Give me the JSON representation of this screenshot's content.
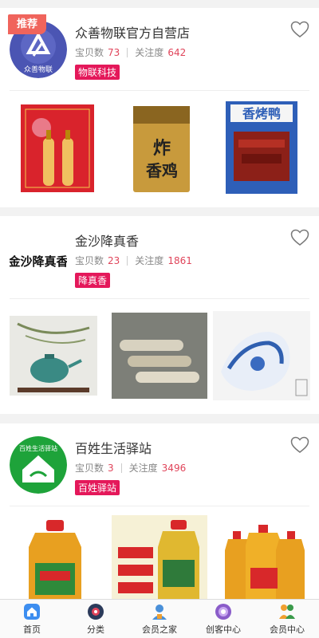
{
  "stores": [
    {
      "tag": "推荐",
      "name": "众善物联官方自营店",
      "items_label": "宝贝数",
      "items_count": "73",
      "follow_label": "关注度",
      "follow_count": "642",
      "badge": "物联科技",
      "logo_text": "众善物联",
      "products": [
        "red-liquor-gift-box",
        "fried-chicken-snack-pack",
        "roast-duck-snack-pack"
      ],
      "product_texts": [
        "炸香鸡",
        "香烤鸭"
      ]
    },
    {
      "name": "金沙降真香",
      "items_label": "宝贝数",
      "items_count": "23",
      "follow_label": "关注度",
      "follow_count": "1861",
      "badge": "降真香",
      "logo_text": "金沙降真香",
      "products": [
        "teapot-with-branches",
        "metal-incense-tubes",
        "blue-white-porcelain-vase"
      ]
    },
    {
      "name": "百姓生活驿站",
      "items_label": "宝贝数",
      "items_count": "3",
      "follow_label": "关注度",
      "follow_count": "3496",
      "badge": "百姓驿站",
      "logo_text": "百姓生活驿站",
      "products": [
        "cooking-oil-bottle-green",
        "cooking-oil-bottle-gift",
        "cooking-oil-three-bottles"
      ]
    }
  ],
  "tabbar": [
    {
      "label": "首页",
      "icon": "home-icon",
      "color": "#3d8ef0"
    },
    {
      "label": "分类",
      "icon": "category-icon",
      "color": "#2b3a5a"
    },
    {
      "label": "会员之家",
      "icon": "member-home-icon",
      "color": "#4a90d9"
    },
    {
      "label": "创客中心",
      "icon": "maker-center-icon",
      "color": "#8a5cc9"
    },
    {
      "label": "会员中心",
      "icon": "member-center-icon",
      "color": "#f0a030"
    }
  ],
  "colors": {
    "accent": "#e4185a",
    "tag": "#f0645c",
    "number": "#e0445a"
  }
}
